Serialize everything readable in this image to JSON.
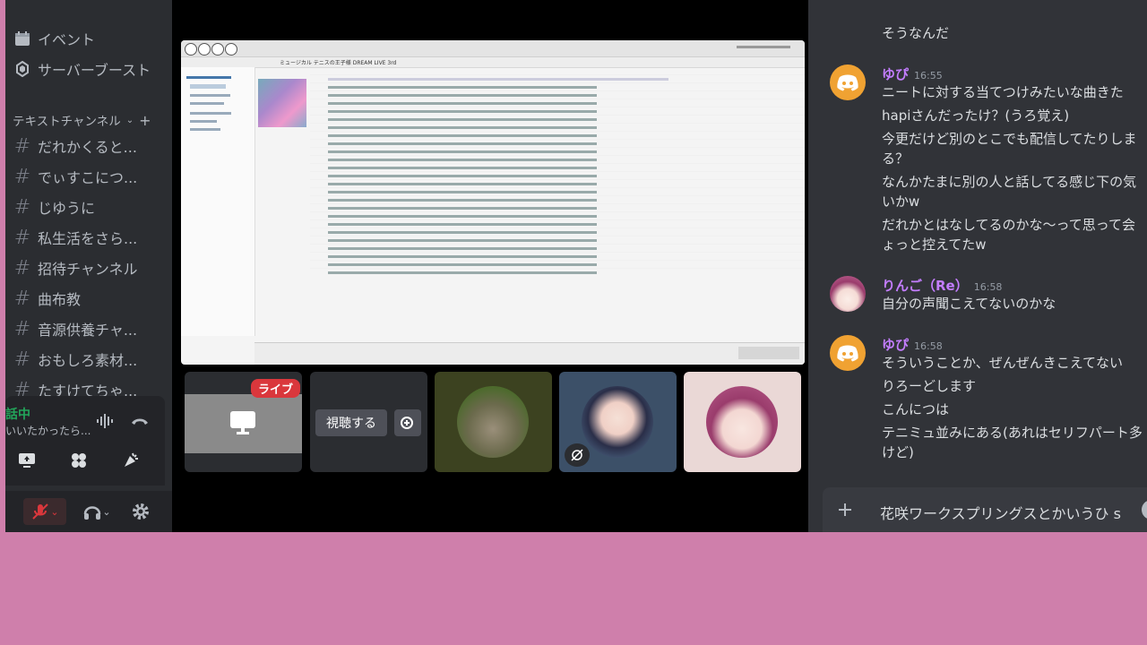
{
  "sidebar": {
    "nav": [
      {
        "label": "イベント",
        "icon": "calendar-icon"
      },
      {
        "label": "サーバーブースト",
        "icon": "boost-icon"
      }
    ],
    "section_title": "テキストチャンネル",
    "channels": [
      {
        "label": "だれかくると..."
      },
      {
        "label": "でぃすこにつ..."
      },
      {
        "label": "じゆうに"
      },
      {
        "label": "私生活をさら..."
      },
      {
        "label": "招待チャンネル"
      },
      {
        "label": "曲布教"
      },
      {
        "label": "音源供養チャ..."
      },
      {
        "label": "おもしろ素材..."
      },
      {
        "label": "たすけてちゃ..."
      }
    ],
    "voice": {
      "status": "話中",
      "channel": "いいたかったら..."
    }
  },
  "stage": {
    "live_badge": "ライブ",
    "watch_label": "視聴する",
    "share_window_title": "ミュージカル テニスの王子様 DREAM LIVE 3rd"
  },
  "chat": {
    "messages": [
      {
        "type": "continuation",
        "text": "そうなんだ"
      },
      {
        "type": "header",
        "author": "ゆぴ",
        "color": "#c37dff",
        "time": "16:55",
        "lines": [
          "ニートに対する当てつけみたいな曲きた",
          "hapiさんだったけ？(うろ覚え)",
          "今更だけど別のとこでも配信してたりしま",
          "る？",
          "なんかたまに別の人と話してる感じ下の気",
          "いかw",
          "だれかとはなしてるのかな～って思って会",
          "ょっと控えてたw"
        ]
      },
      {
        "type": "header",
        "author": "りんご（Re）",
        "color": "#c37dff",
        "time": "16:58",
        "lines": [
          "自分の声聞こえてないのかな"
        ]
      },
      {
        "type": "header",
        "author": "ゆぴ",
        "color": "#c37dff",
        "time": "16:58",
        "lines": [
          "そういうことか、ぜんぜんきこえてない",
          "りろーどします",
          "こんにつは",
          "テニミュ並みにある(あれはセリフパート多",
          "けど)"
        ]
      }
    ],
    "input_value": "花咲ワークスプリングスとかいうひ s",
    "colors": {
      "accent": "#5865f2",
      "author": "#c37dff"
    }
  }
}
